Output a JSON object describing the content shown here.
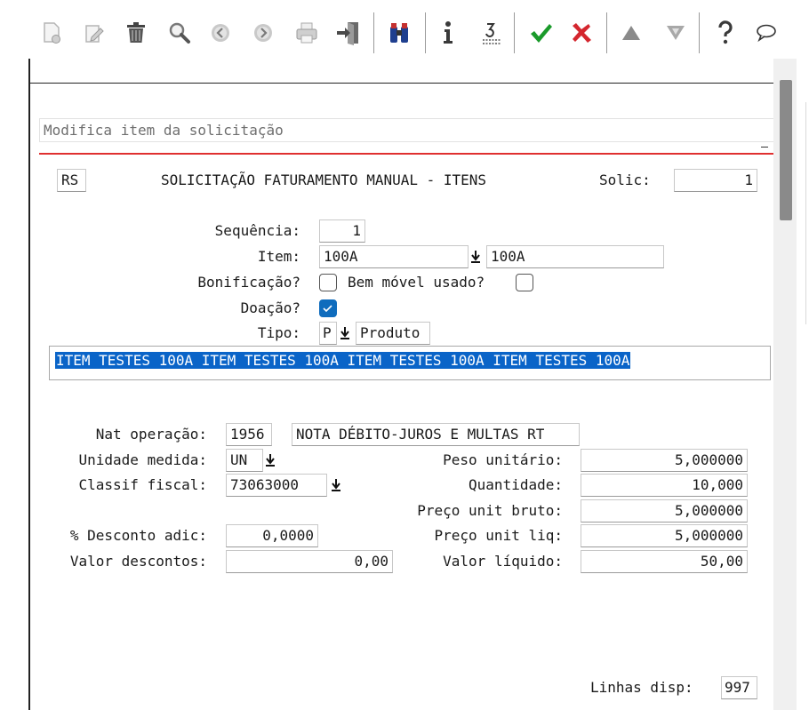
{
  "toolbar": {
    "icons": [
      "new-record-icon",
      "edit-icon",
      "trash-icon",
      "search-icon",
      "previous-icon",
      "next-icon",
      "print-icon",
      "exit-door-icon",
      "binoculars-icon",
      "info-icon",
      "list-icon",
      "confirm-check-icon",
      "cancel-x-icon",
      "up-arrow-icon",
      "down-arrow-icon",
      "help-question-icon",
      "comment-bubble-icon"
    ],
    "accent_green": "#1a9a2a",
    "accent_red": "#d4262e"
  },
  "program": {
    "subtitle": "Modifica item da solicitação",
    "code": "RS",
    "title": "SOLICITAÇÃO FATURAMENTO MANUAL - ITENS",
    "solic_label": "Solic:",
    "solic_value": "1"
  },
  "form": {
    "sequencia_label": "Sequência:",
    "sequencia_value": "1",
    "item_label": "Item:",
    "item_code": "100A",
    "item_code2": "100A",
    "bonificacao_label": "Bonificação?",
    "bonificacao_checked": false,
    "bem_movel_label": "Bem móvel usado?",
    "bem_movel_checked": false,
    "doacao_label": "Doação?",
    "doacao_checked": true,
    "tipo_label": "Tipo:",
    "tipo_value": "P",
    "tipo_desc": "Produto",
    "item_description": "ITEM TESTES 100A ITEM TESTES 100A ITEM TESTES 100A ITEM TESTES 100A",
    "nat_operacao_label": "Nat operação:",
    "nat_operacao_value": "1956",
    "nat_operacao_desc": "NOTA DÉBITO-JUROS E MULTAS RT",
    "unidade_label": "Unidade medida:",
    "unidade_value": "UN",
    "classif_label": "Classif fiscal:",
    "classif_value": "73063000",
    "desconto_label": "% Desconto adic:",
    "desconto_value": "0,0000",
    "valor_descontos_label": "Valor descontos:",
    "valor_descontos_value": "0,00",
    "peso_label": "Peso unitário:",
    "peso_value": "5,000000",
    "quantidade_label": "Quantidade:",
    "quantidade_value": "10,000",
    "preco_bruto_label": "Preço unit bruto:",
    "preco_bruto_value": "5,000000",
    "preco_liq_label": "Preço unit liq:",
    "preco_liq_value": "5,000000",
    "valor_liquido_label": "Valor líquido:",
    "valor_liquido_value": "50,00",
    "linhas_label": "Linhas disp:",
    "linhas_value": "997"
  }
}
